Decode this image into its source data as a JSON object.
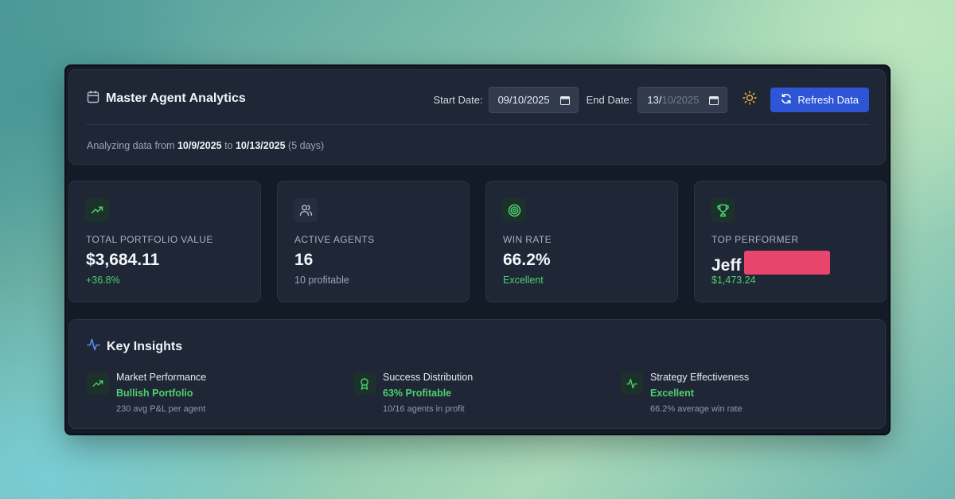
{
  "header": {
    "title": "Master Agent Analytics",
    "start_label": "Start Date:",
    "start_value": "09/10/2025",
    "end_label": "End Date:",
    "end_value_day": "13/",
    "end_value_month": "10/",
    "end_value_year": "2025",
    "refresh_label": "Refresh Data",
    "analyzing_prefix": "Analyzing data from",
    "range_start": "10/9/2025",
    "range_to": "to",
    "range_end": "10/13/2025",
    "range_days": "(5 days)"
  },
  "cards": [
    {
      "label": "TOTAL PORTFOLIO VALUE",
      "value": "$3,684.11",
      "sub": "+36.8%",
      "icon": "trending-up-icon"
    },
    {
      "label": "ACTIVE AGENTS",
      "value": "16",
      "sub": "10 profitable",
      "icon": "users-icon"
    },
    {
      "label": "WIN RATE",
      "value": "66.2%",
      "sub": "Excellent",
      "icon": "target-icon"
    },
    {
      "label": "TOP PERFORMER",
      "value": "Jeff",
      "sub": "$1,473.24",
      "icon": "trophy-icon"
    }
  ],
  "insights": {
    "title": "Key Insights",
    "items": [
      {
        "title": "Market Performance",
        "status": "Bullish Portfolio",
        "detail": "230 avg P&L per agent",
        "icon": "trending-up-icon"
      },
      {
        "title": "Success Distribution",
        "status": "63% Profitable",
        "detail": "10/16 agents in profit",
        "icon": "award-icon"
      },
      {
        "title": "Strategy Effectiveness",
        "status": "Excellent",
        "detail": "66.2% average win rate",
        "icon": "activity-icon"
      }
    ]
  },
  "colors": {
    "accent": "#2d55d6",
    "positive": "#4ed06e",
    "redaction": "#e8456c",
    "sun": "#f0b43c"
  }
}
